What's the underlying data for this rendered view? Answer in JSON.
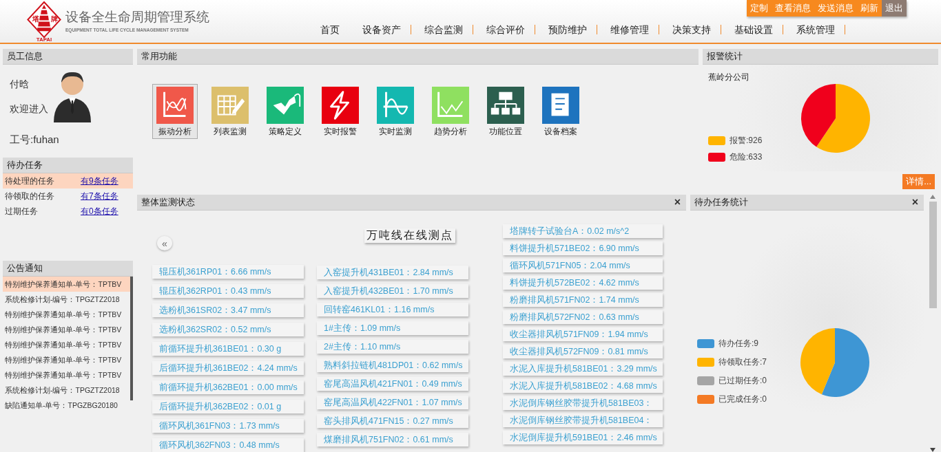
{
  "header": {
    "logo": {
      "left": "塔",
      "right": "牌",
      "bottom": "TAPAI"
    },
    "title": "设备全生命周期管理系统",
    "subtitle": "EQUIPMENT TOTAL LIFE CYCLE MANAGEMENT SYSTEM",
    "toolbar": [
      {
        "label": "定制",
        "kind": "action"
      },
      {
        "label": "查看消息",
        "kind": "action"
      },
      {
        "label": "发送消息",
        "kind": "action"
      },
      {
        "label": "刷新",
        "kind": "action"
      },
      {
        "label": "退出",
        "kind": "exit"
      }
    ],
    "nav": [
      "首页",
      "设备资产",
      "综合监测",
      "综合评价",
      "预防维护",
      "维修管理",
      "决策支持",
      "基础设置",
      "系统管理"
    ]
  },
  "employee": {
    "title": "员工信息",
    "name": "付晗",
    "welcome": "欢迎进入",
    "id_label": "工号:fuhan"
  },
  "tasks": {
    "title": "待办任务",
    "rows": [
      {
        "label": "待处理的任务",
        "link": "有9条任务",
        "selected": true
      },
      {
        "label": "待领取的任务",
        "link": "有7条任务",
        "selected": false
      },
      {
        "label": "过期任务",
        "link": "有0条任务",
        "selected": false
      }
    ]
  },
  "notices": {
    "title": "公告通知",
    "items": [
      {
        "text": "特别维护保养通知单-单号：TPTBV",
        "selected": true
      },
      {
        "text": "系统检修计划-编号：TPGZTZ2018",
        "selected": false
      },
      {
        "text": "特别维护保养通知单-单号：TPTBV",
        "selected": false
      },
      {
        "text": "特别维护保养通知单-单号：TPTBV",
        "selected": false
      },
      {
        "text": "特别维护保养通知单-单号：TPTBV",
        "selected": false
      },
      {
        "text": "特别维护保养通知单-单号：TPTBV",
        "selected": false
      },
      {
        "text": "特别维护保养通知单-单号：TPTBV",
        "selected": false
      },
      {
        "text": "系统检修计划-编号：TPGZTZ2018",
        "selected": false
      },
      {
        "text": "缺陷通知单-单号：TPGZBG20180",
        "selected": false
      }
    ]
  },
  "functions": {
    "title": "常用功能",
    "items": [
      {
        "label": "振动分析",
        "selected": true
      },
      {
        "label": "列表监测",
        "selected": false
      },
      {
        "label": "策略定义",
        "selected": false
      },
      {
        "label": "实时报警",
        "selected": false
      },
      {
        "label": "实时监测",
        "selected": false
      },
      {
        "label": "趋势分析",
        "selected": false
      },
      {
        "label": "功能位置",
        "selected": false
      },
      {
        "label": "设备档案",
        "selected": false
      }
    ]
  },
  "alarm_stats": {
    "title": "报警统计",
    "company": "蕉岭分公司",
    "legend": [
      {
        "label": "报警:926",
        "color": "#ffb400"
      },
      {
        "label": "危险:633",
        "color": "#f0001c"
      }
    ],
    "chart_data": {
      "type": "pie",
      "values": [
        59.4,
        40.6
      ]
    },
    "details_button": "详情..."
  },
  "monitor": {
    "title": "整体监测状态",
    "close": "×",
    "collapse": "«",
    "heading": "万吨线在线测点",
    "columns": [
      [
        "辊压机361RP01：6.66 mm/s",
        "辊压机362RP01：0.43 mm/s",
        "选粉机361SR02：3.47 mm/s",
        "选粉机362SR02：0.52 mm/s",
        "前循环提升机361BE01：0.30 g",
        "后循环提升机361BE02：4.24 mm/s",
        "前循环提升机362BE01：0.00 mm/s",
        "后循环提升机362BE02：0.01 g",
        "循环风机361FN03：1.73 mm/s",
        "循环风机362FN03：0.48 mm/s"
      ],
      [
        "入窑提升机431BE01：2.84 mm/s",
        "入窑提升机432BE01：1.70 mm/s",
        "回转窑461KL01：1.16 mm/s",
        "1#主传：1.09 mm/s",
        "2#主传：1.10 mm/s",
        "熟料斜拉链机481DP01：0.62 mm/s",
        "窑尾高温风机421FN01：0.49 mm/s",
        "窑尾高温风机422FN01：1.07 mm/s",
        "窑头排风机471FN15：0.27 mm/s",
        "煤磨排风机751FN02：0.61 mm/s"
      ],
      [
        "塔牌转子试验台A：0.02 m/s^2",
        "料饼提升机571BE02：6.90 mm/s",
        "循环风机571FN05：2.04 mm/s",
        "料饼提升机572BE02：4.62 mm/s",
        "粉磨排风机571FN02：1.74 mm/s",
        "粉磨排风机572FN02：0.63 mm/s",
        "收尘器排风机571FN09：1.94 mm/s",
        "收尘器排风机572FN09：0.81 mm/s",
        "水泥入库提升机581BE01：3.29 mm/s",
        "水泥入库提升机581BE02：4.68 mm/s",
        "水泥倒库钢丝胶带提升机581BE03：",
        "水泥倒库钢丝胶带提升机581BE04：",
        "水泥倒库提升机591BE01：2.46 mm/s"
      ]
    ]
  },
  "task_stats": {
    "title": "待办任务统计",
    "close": "×",
    "legend": [
      {
        "label": "待办任务:9",
        "color": "#3e96d4"
      },
      {
        "label": "待领取任务:7",
        "color": "#ffb400"
      },
      {
        "label": "已过期任务:0",
        "color": "#a5a5a5"
      },
      {
        "label": "已完成任务:0",
        "color": "#f47a24"
      }
    ],
    "chart_data": {
      "type": "pie",
      "values": [
        56.25,
        43.75,
        0,
        0
      ]
    }
  }
}
